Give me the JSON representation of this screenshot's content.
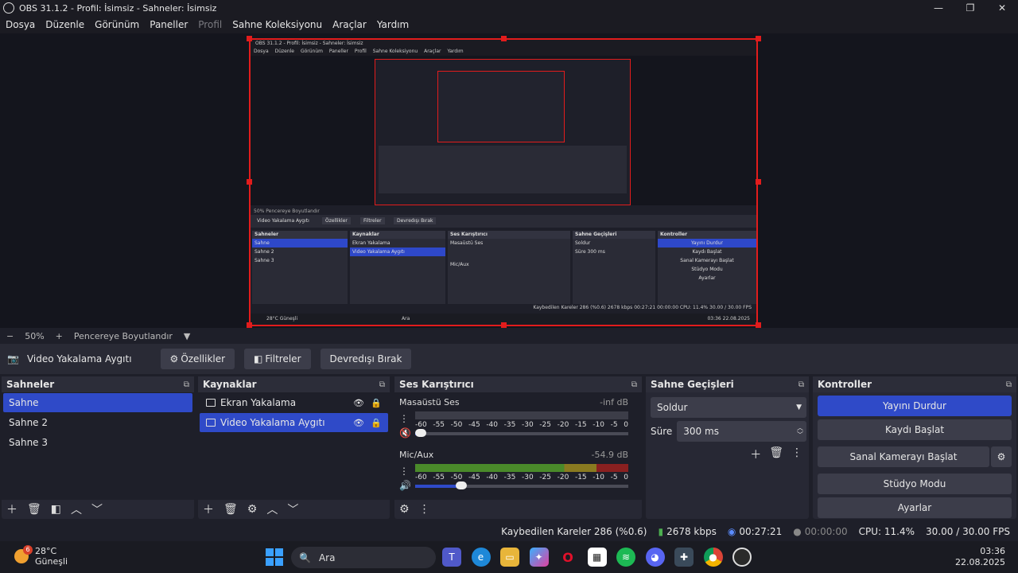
{
  "window": {
    "title": "OBS 31.1.2 - Profil: İsimsiz - Sahneler: İsimsiz",
    "controls": [
      "—",
      "❐",
      "✕"
    ]
  },
  "menu": [
    "Dosya",
    "Düzenle",
    "Görünüm",
    "Paneller",
    "Profil",
    "Sahne Koleksiyonu",
    "Araçlar",
    "Yardım"
  ],
  "zoom": {
    "minus": "−",
    "level": "50%",
    "plus": "+",
    "fit": "Pencereye Boyutlandır",
    "arrow": "▼"
  },
  "source_toolbar": {
    "source_name": "Video Yakalama Aygıtı",
    "properties": "Özellikler",
    "filters": "Filtreler",
    "deactivate": "Devredışı Bırak"
  },
  "scenes": {
    "title": "Sahneler",
    "items": [
      "Sahne",
      "Sahne 2",
      "Sahne 3"
    ],
    "selected": 0
  },
  "sources": {
    "title": "Kaynaklar",
    "items": [
      "Ekran Yakalama",
      "Video Yakalama Aygıtı"
    ],
    "selected": 1
  },
  "mixer": {
    "title": "Ses Karıştırıcı",
    "channels": [
      {
        "name": "Masaüstü Ses",
        "db": "-inf dB",
        "volume": 0.0,
        "muted": true
      },
      {
        "name": "Mic/Aux",
        "db": "-54.9 dB",
        "volume": 0.2,
        "muted": false
      }
    ],
    "ticks": [
      "-60",
      "-55",
      "-50",
      "-45",
      "-40",
      "-35",
      "-30",
      "-25",
      "-20",
      "-15",
      "-10",
      "-5",
      "0"
    ]
  },
  "transitions": {
    "title": "Sahne Geçişleri",
    "selected": "Soldur",
    "duration_label": "Süre",
    "duration": "300 ms"
  },
  "controls": {
    "title": "Kontroller",
    "stop_stream": "Yayını Durdur",
    "start_record": "Kaydı Başlat",
    "virtual_cam": "Sanal Kamerayı Başlat",
    "studio_mode": "Stüdyo Modu",
    "settings": "Ayarlar"
  },
  "status": {
    "dropped": "Kaybedilen Kareler 286 (%0.6)",
    "bitrate": "2678 kbps",
    "stream_time": "00:27:21",
    "record_time": "00:00:00",
    "cpu": "CPU: 11.4%",
    "fps": "30.00 / 30.00 FPS"
  },
  "nested": {
    "title": "OBS 31.1.2 - Profil: İsimsiz - Sahneler: İsimsiz",
    "menu": [
      "Dosya",
      "Düzenle",
      "Görünüm",
      "Paneller",
      "Profil",
      "Sahne Koleksiyonu",
      "Araçlar",
      "Yardım"
    ],
    "zoom": "50%   Pencereye Boyutlandır",
    "source_name": "Video Yakalama Aygıtı",
    "properties": "Özellikler",
    "filters": "Filtreler",
    "deactivate": "Devredışı Bırak",
    "scenes_title": "Sahneler",
    "scenes": [
      "Sahne",
      "Sahne 2",
      "Sahne 3"
    ],
    "sources_title": "Kaynaklar",
    "sources": [
      "Ekran Yakalama",
      "Video Yakalama Aygıtı"
    ],
    "mixer_title": "Ses Karıştırıcı",
    "mixer_ch": [
      "Masaüstü Ses",
      "Mic/Aux"
    ],
    "trans_title": "Sahne Geçişleri",
    "trans_sel": "Soldur",
    "trans_dur": "Süre   300 ms",
    "ctrl_title": "Kontroller",
    "ctrl": [
      "Yayını Durdur",
      "Kaydı Başlat",
      "Sanal Kamerayı Başlat",
      "Stüdyo Modu",
      "Ayarlar"
    ],
    "status": "Kaybedilen Kareler 286 (%0.6)   2678 kbps   00:27:21   00:00:00   CPU: 11.4%   30.00 / 30.00 FPS",
    "weather": "28°C Güneşli",
    "search": "Ara",
    "clock": "03:36 22.08.2025"
  },
  "taskbar": {
    "weather_temp": "28°C",
    "weather_desc": "Güneşli",
    "weather_badge": "6",
    "search": "Ara",
    "time": "03:36",
    "date": "22.08.2025",
    "icons": [
      "teams-icon",
      "edge-icon",
      "explorer-icon",
      "copilot-icon",
      "opera-icon",
      "store-icon",
      "spotify-icon",
      "discord-icon",
      "app-icon",
      "chrome-icon",
      "obs-icon"
    ]
  },
  "colors": {
    "accent": "#2f4ac8",
    "selection_border": "#e21c1c",
    "panel": "#272834",
    "background": "#1e1f29"
  }
}
